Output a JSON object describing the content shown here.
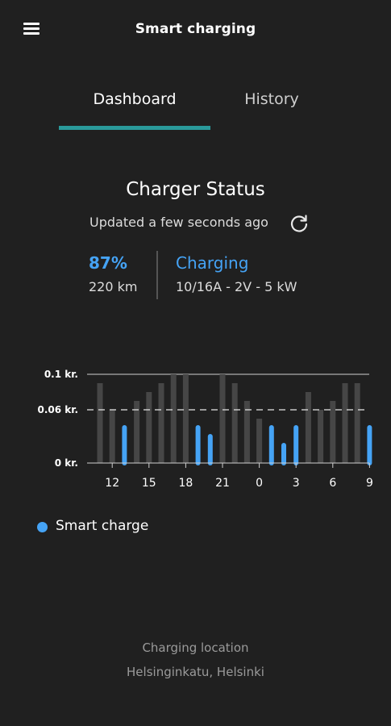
{
  "app": {
    "title": "Smart charging",
    "menu_icon": "hamburger-menu-icon"
  },
  "tabs": [
    {
      "label": "Dashboard",
      "active": true
    },
    {
      "label": "History",
      "active": false
    }
  ],
  "accent": "#2a9a9b",
  "highlight": "#45a3f5",
  "status": {
    "title": "Charger Status",
    "updated": "Updated a few seconds ago",
    "refresh_icon": "refresh-icon",
    "battery_percent": "87%",
    "range": "220 km",
    "state": "Charging",
    "power": "10/16A - 2V - 5 kW"
  },
  "chart_data": {
    "type": "bar",
    "title": "",
    "xlabel": "",
    "ylabel": "",
    "ylim": [
      0,
      0.1
    ],
    "ytick_labels": [
      "0.1 kr.",
      "0.06 kr.",
      "0 kr."
    ],
    "ytick_values": [
      0.1,
      0.06,
      0
    ],
    "reference_line": 0.06,
    "xtick_labels": [
      "12",
      "15",
      "18",
      "21",
      "0",
      "3",
      "6",
      "9"
    ],
    "categories": [
      "11",
      "12",
      "13",
      "14",
      "15",
      "16",
      "17",
      "18",
      "19",
      "20",
      "21",
      "22",
      "23",
      "0",
      "1",
      "2",
      "3",
      "4",
      "5",
      "6",
      "7",
      "8",
      "9"
    ],
    "values": [
      0.09,
      0.06,
      0.04,
      0.07,
      0.08,
      0.09,
      0.1,
      0.1,
      0.04,
      0.03,
      0.1,
      0.09,
      0.07,
      0.05,
      0.04,
      0.02,
      0.04,
      0.08,
      0.06,
      0.07,
      0.09,
      0.09,
      0.04
    ],
    "smart_charge": [
      false,
      false,
      true,
      false,
      false,
      false,
      false,
      false,
      true,
      true,
      false,
      false,
      false,
      false,
      true,
      true,
      true,
      false,
      false,
      false,
      false,
      false,
      true
    ],
    "colors": {
      "price": "#464646",
      "smart_charge": "#45a3f5"
    },
    "legend": [
      {
        "label": "Smart charge",
        "color": "#45a3f5"
      }
    ]
  },
  "location": {
    "label": "Charging location",
    "value": "Helsinginkatu, Helsinki"
  }
}
